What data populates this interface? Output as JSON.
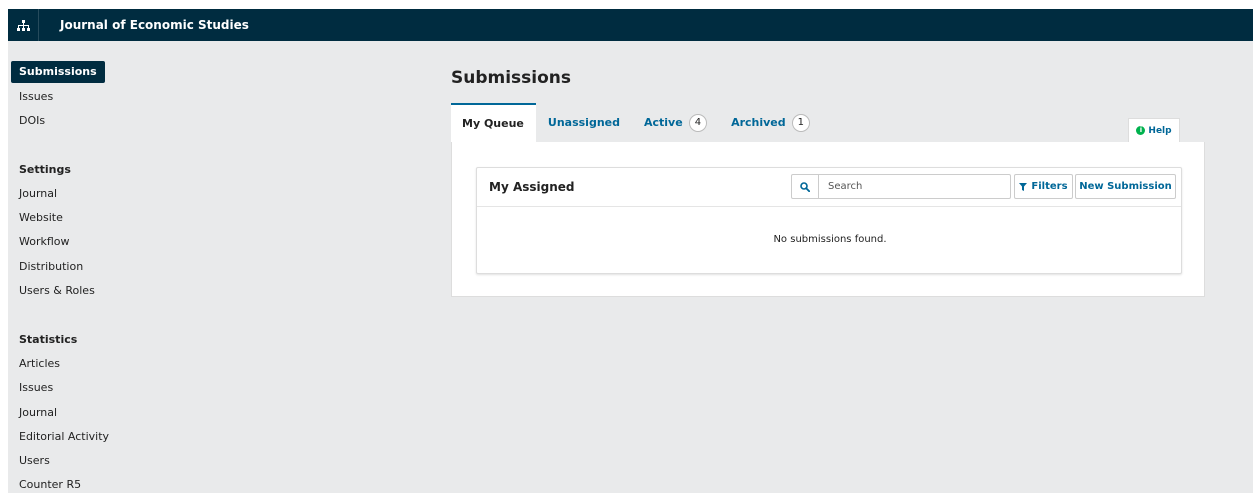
{
  "header": {
    "journal_name": "Journal of Economic Studies",
    "nav_icon": "sitemap-icon"
  },
  "sidebar": {
    "items": [
      "Submissions",
      "Issues",
      "DOIs"
    ],
    "settings_heading": "Settings",
    "settings_items": [
      "Journal",
      "Website",
      "Workflow",
      "Distribution",
      "Users & Roles"
    ],
    "statistics_heading": "Statistics",
    "statistics_items": [
      "Articles",
      "Issues",
      "Journal",
      "Editorial Activity",
      "Users",
      "Counter R5"
    ]
  },
  "main": {
    "title": "Submissions",
    "tabs": [
      {
        "label": "My Queue"
      },
      {
        "label": "Unassigned"
      },
      {
        "label": "Active",
        "count": "4"
      },
      {
        "label": "Archived",
        "count": "1"
      }
    ],
    "help_label": "Help",
    "help_icon": "info-circle-icon",
    "list": {
      "title": "My Assigned",
      "search_placeholder": "Search",
      "search_value": "",
      "filters_label": "Filters",
      "new_submission_label": "New Submission",
      "empty_message": "No submissions found."
    }
  },
  "colors": {
    "header_bg": "#002c40",
    "link": "#006798",
    "page_bg": "#e9eaeb",
    "help_accent": "#00b24e"
  }
}
